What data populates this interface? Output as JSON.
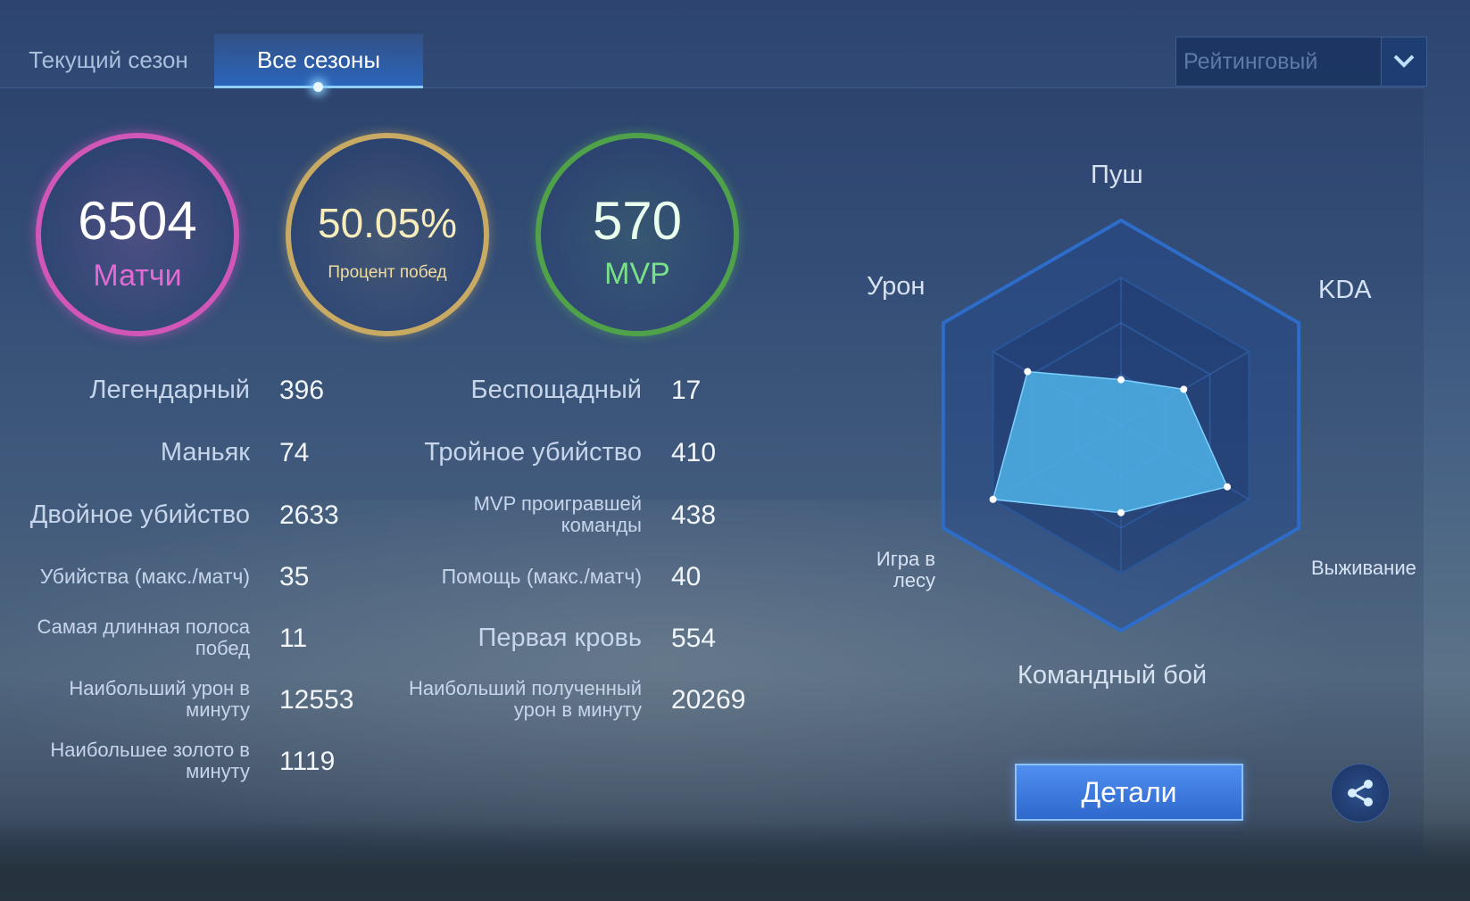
{
  "tabs": [
    {
      "label": "Текущий сезон",
      "active": false
    },
    {
      "label": "Все сезоны",
      "active": true
    }
  ],
  "mode_select": {
    "value": "Рейтинговый",
    "icon": "chevron-down-icon"
  },
  "summary": {
    "matches": {
      "value": "6504",
      "label": "Матчи",
      "color": "#d056b8"
    },
    "win_rate": {
      "value": "50.05%",
      "label": "Процент побед",
      "color": "#c8aa63"
    },
    "mvp": {
      "value": "570",
      "label": "MVP",
      "color": "#4fa24a"
    }
  },
  "stats_left": [
    {
      "label": "Легендарный",
      "value": "396"
    },
    {
      "label": "Маньяк",
      "value": "74"
    },
    {
      "label": "Двойное убийство",
      "value": "2633"
    },
    {
      "label": "Убийства (макс./матч)",
      "value": "35"
    },
    {
      "label_lines": [
        "Самая длинная полоса",
        "побед"
      ],
      "value": "11"
    },
    {
      "label_lines": [
        "Наибольший урон в",
        "минуту"
      ],
      "value": "12553"
    },
    {
      "label_lines": [
        "Наибольшее золото в",
        "минуту"
      ],
      "value": "1119"
    }
  ],
  "stats_right": [
    {
      "label": "Беспощадный",
      "value": "17"
    },
    {
      "label": "Тройное убийство",
      "value": "410"
    },
    {
      "label_lines": [
        "MVP проигравшей",
        "команды"
      ],
      "value": "438"
    },
    {
      "label": "Помощь (макс./матч)",
      "value": "40"
    },
    {
      "label": "Первая кровь",
      "value": "554"
    },
    {
      "label_lines": [
        "Наибольший полученный",
        "урон в минуту"
      ],
      "value": "20269"
    }
  ],
  "radar": {
    "axes": [
      "Пуш",
      "KDA",
      "Выживание",
      "Командный бой",
      "Игра в лесу",
      "Урон"
    ],
    "jungle_label_lines": [
      "Игра в",
      "лесу"
    ],
    "values": [
      0.31,
      0.49,
      0.83,
      0.59,
      1.0,
      0.73
    ],
    "fill_color": "#4fb3e8"
  },
  "buttons": {
    "details": "Детали",
    "share_icon": "share-icon"
  }
}
